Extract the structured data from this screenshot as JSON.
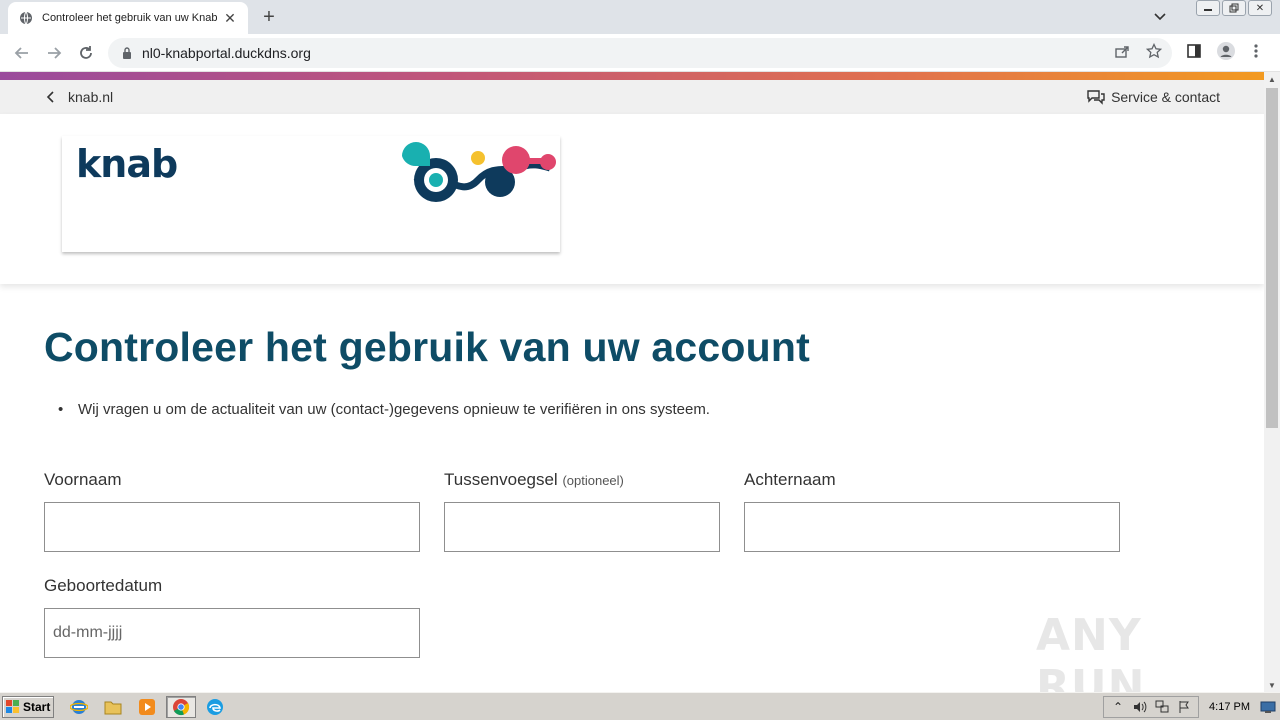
{
  "browser": {
    "tab_title": "Controleer het gebruik van uw Knab",
    "url": "nl0-knabportal.duckdns.org"
  },
  "page": {
    "back_link": "knab.nl",
    "service_link": "Service & contact",
    "brand": "knab",
    "heading": "Controleer het gebruik van uw account",
    "bullets": [
      "Wij vragen u om de actualiteit van uw (contact-)gegevens opnieuw te verifiëren in ons systeem."
    ],
    "form": {
      "first_name_label": "Voornaam",
      "infix_label": "Tussenvoegsel",
      "infix_optional": "(optioneel)",
      "last_name_label": "Achternaam",
      "birthdate_label": "Geboortedatum",
      "birthdate_placeholder": "dd-mm-jjjj"
    },
    "watermark": "ANY RUN"
  },
  "colors": {
    "heading": "#0e4c66",
    "brand": "#0e3a5c",
    "gradient_start": "#9a4b9c",
    "gradient_end": "#f29a21"
  },
  "taskbar": {
    "start_label": "Start",
    "clock": "4:17 PM"
  }
}
